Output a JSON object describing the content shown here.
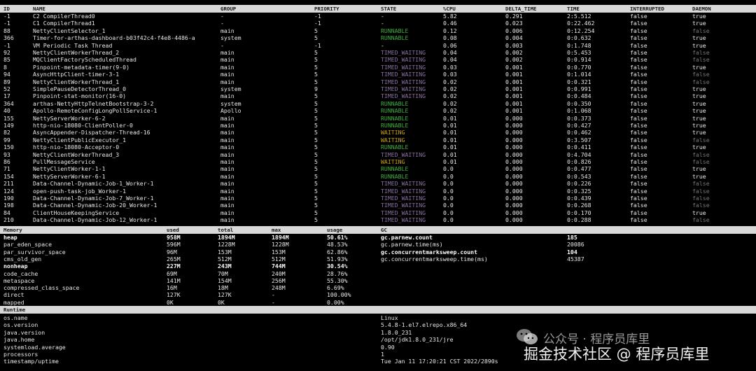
{
  "thread_table": {
    "headers": [
      "ID",
      "NAME",
      "GROUP",
      "PRIORITY",
      "STATE",
      "%CPU",
      "DELTA_TIME",
      "TIME",
      "INTERRUPTED",
      "DAEMON"
    ],
    "rows": [
      [
        "-1",
        "C2 CompilerThread0",
        "-",
        "-1",
        "-",
        "5.82",
        "0.291",
        "2:5.512",
        "false",
        "true"
      ],
      [
        "-1",
        "C1 CompilerThread1",
        "-",
        "-1",
        "-",
        "0.46",
        "0.023",
        "0:22.462",
        "false",
        "true"
      ],
      [
        "88",
        "NettyClientSelector_1",
        "main",
        "5",
        "RUNNABLE",
        "0.12",
        "0.006",
        "0:12.254",
        "false",
        "false"
      ],
      [
        "366",
        "Timer-for-arthas-dashboard-b03f42c4-f4e8-4486-a",
        "system",
        "5",
        "RUNNABLE",
        "0.08",
        "0.004",
        "0:0.632",
        "false",
        "true"
      ],
      [
        "-1",
        "VM Periodic Task Thread",
        "-",
        "-1",
        "-",
        "0.06",
        "0.003",
        "0:1.748",
        "false",
        "true"
      ],
      [
        "92",
        "NettyClientWorkerThread_2",
        "main",
        "5",
        "TIMED_WAITING",
        "0.04",
        "0.002",
        "0:5.453",
        "false",
        "false"
      ],
      [
        "85",
        "MQClientFactoryScheduledThread",
        "main",
        "5",
        "TIMED_WAITING",
        "0.04",
        "0.002",
        "0:0.914",
        "false",
        "false"
      ],
      [
        "8",
        "Pinpoint-metadata-timer(9-0)",
        "main",
        "5",
        "TIMED_WAITING",
        "0.03",
        "0.001",
        "0:0.770",
        "false",
        "true"
      ],
      [
        "94",
        "AsyncHttpClient-timer-3-1",
        "main",
        "5",
        "TIMED_WAITING",
        "0.03",
        "0.001",
        "0:1.014",
        "false",
        "false"
      ],
      [
        "89",
        "NettyClientWorkerThread_1",
        "main",
        "5",
        "TIMED_WAITING",
        "0.02",
        "0.001",
        "0:0.321",
        "false",
        "false"
      ],
      [
        "52",
        "SimplePauseDetectorThread_0",
        "system",
        "9",
        "TIMED_WAITING",
        "0.02",
        "0.001",
        "0:0.991",
        "false",
        "true"
      ],
      [
        "17",
        "Pinpoint-stat-monitor(16-0)",
        "main",
        "5",
        "TIMED_WAITING",
        "0.02",
        "0.001",
        "0:0.484",
        "false",
        "true"
      ],
      [
        "364",
        "arthas-NettyHttpTelnetBootstrap-3-2",
        "system",
        "5",
        "RUNNABLE",
        "0.02",
        "0.001",
        "0:0.350",
        "false",
        "true"
      ],
      [
        "40",
        "Apollo-RemoteConfigLongPollService-1",
        "Apollo",
        "5",
        "RUNNABLE",
        "0.02",
        "0.001",
        "0:1.068",
        "false",
        "true"
      ],
      [
        "155",
        "NettyServerWorker-6-2",
        "main",
        "5",
        "RUNNABLE",
        "0.01",
        "0.000",
        "0:0.373",
        "false",
        "true"
      ],
      [
        "149",
        "http-nio-18080-ClientPoller-0",
        "main",
        "5",
        "RUNNABLE",
        "0.01",
        "0.000",
        "0:0.427",
        "false",
        "true"
      ],
      [
        "82",
        "AsyncAppender-Dispatcher-Thread-16",
        "main",
        "5",
        "WAITING",
        "0.01",
        "0.000",
        "0:0.462",
        "false",
        "true"
      ],
      [
        "99",
        "NettyClientPublicExecutor_1",
        "main",
        "5",
        "WAITING",
        "0.01",
        "0.000",
        "0:3.507",
        "false",
        "false"
      ],
      [
        "150",
        "http-nio-18080-Acceptor-0",
        "main",
        "5",
        "RUNNABLE",
        "0.01",
        "0.000",
        "0:0.411",
        "false",
        "true"
      ],
      [
        "93",
        "NettyClientWorkerThread_3",
        "main",
        "5",
        "TIMED_WAITING",
        "0.01",
        "0.000",
        "0:4.704",
        "false",
        "false"
      ],
      [
        "86",
        "PullMessageService",
        "main",
        "5",
        "WAITING",
        "0.01",
        "0.000",
        "0:0.826",
        "false",
        "false"
      ],
      [
        "71",
        "NettyClientWorker-1-1",
        "main",
        "5",
        "RUNNABLE",
        "0.0",
        "0.000",
        "0:0.477",
        "false",
        "true"
      ],
      [
        "154",
        "NettyServerWorker-6-1",
        "main",
        "5",
        "RUNNABLE",
        "0.0",
        "0.000",
        "0:0.543",
        "false",
        "true"
      ],
      [
        "211",
        "Data-Channel-Dynamic-Job-1_Worker-1",
        "main",
        "5",
        "TIMED_WAITING",
        "0.0",
        "0.000",
        "0:0.226",
        "false",
        "false"
      ],
      [
        "124",
        "open-push-task-job_Worker-1",
        "main",
        "5",
        "TIMED_WAITING",
        "0.0",
        "0.000",
        "0:0.325",
        "false",
        "false"
      ],
      [
        "190",
        "Data-Channel-Dynamic-Job-7_Worker-1",
        "main",
        "5",
        "TIMED_WAITING",
        "0.0",
        "0.000",
        "0:0.439",
        "false",
        "false"
      ],
      [
        "198",
        "Data-Channel-Dynamic-Job-20_Worker-1",
        "main",
        "5",
        "TIMED_WAITING",
        "0.0",
        "0.000",
        "0:0.268",
        "false",
        "false"
      ],
      [
        "84",
        "ClientHouseKeepingService",
        "main",
        "5",
        "TIMED_WAITING",
        "0.0",
        "0.000",
        "0:0.170",
        "false",
        "true"
      ],
      [
        "210",
        "Data-Channel-Dynamic-Job-12_Worker-1",
        "main",
        "5",
        "TIMED_WAITING",
        "0.0",
        "0.000",
        "0:0.288",
        "false",
        "false"
      ]
    ]
  },
  "memory_table": {
    "headers": [
      "Memory",
      "used",
      "total",
      "max",
      "usage"
    ],
    "rows": [
      [
        "heap",
        "958M",
        "1894M",
        "1894M",
        "50.61%"
      ],
      [
        "par_eden_space",
        "596M",
        "1228M",
        "1228M",
        "48.53%"
      ],
      [
        "par_survivor_space",
        "96M",
        "153M",
        "153M",
        "62.86%"
      ],
      [
        "cms_old_gen",
        "265M",
        "512M",
        "512M",
        "51.93%"
      ],
      [
        "nonheap",
        "227M",
        "243M",
        "744M",
        "30.54%"
      ],
      [
        "code_cache",
        "69M",
        "70M",
        "240M",
        "28.76%"
      ],
      [
        "metaspace",
        "141M",
        "154M",
        "256M",
        "55.30%"
      ],
      [
        "compressed_class_space",
        "16M",
        "18M",
        "248M",
        "6.69%"
      ],
      [
        "direct",
        "127K",
        "127K",
        "-",
        "100.00%"
      ],
      [
        "mapped",
        "0K",
        "0K",
        "-",
        "0.00%"
      ]
    ]
  },
  "gc_table": {
    "header": "GC",
    "rows": [
      [
        "gc.parnew.count",
        "185"
      ],
      [
        "gc.parnew.time(ms)",
        "20086"
      ],
      [
        "gc.concurrentmarksweep.count",
        "104"
      ],
      [
        "gc.concurrentmarksweep.time(ms)",
        "45387"
      ]
    ]
  },
  "runtime_table": {
    "header": "Runtime",
    "rows": [
      [
        "os.name",
        "Linux"
      ],
      [
        "os.version",
        "5.4.8-1.el7.elrepo.x86_64"
      ],
      [
        "java.version",
        "1.8.0_231"
      ],
      [
        "java.home",
        "/opt/jdk1.8.0_231/jre"
      ],
      [
        "systemload.average",
        "0.90"
      ],
      [
        "processors",
        "1"
      ],
      [
        "timestamp/uptime",
        "Tue Jan 11 17:20:21 CST 2022/2890s"
      ]
    ]
  },
  "watermark": {
    "line1": "公众号 · 程序员库里",
    "line2": "掘金技术社区 @ 程序员库里"
  },
  "colors": {
    "runnable": "#3fae3f",
    "timed_waiting": "#8b6fa0",
    "waiting": "#c8a400",
    "header_bg": "#d8d8d8"
  }
}
